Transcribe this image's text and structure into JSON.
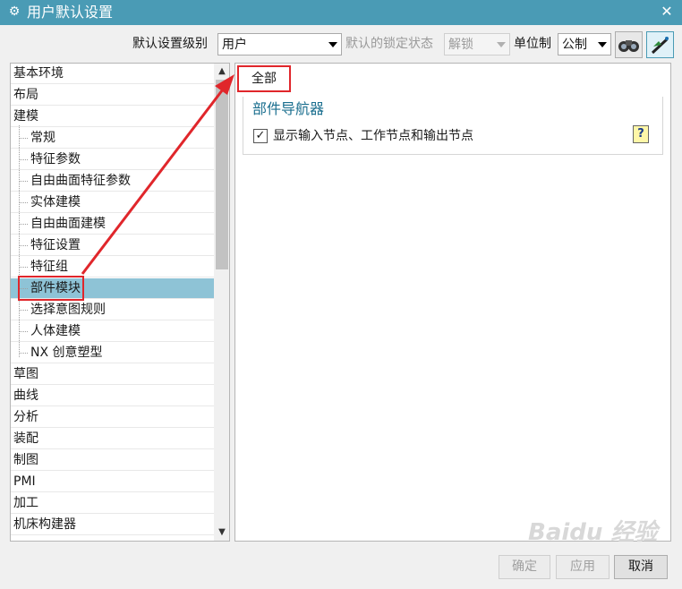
{
  "window": {
    "title": "用户默认设置",
    "close_label": "✕",
    "title_icon": "⚙"
  },
  "toolbar": {
    "level_label": "默认设置级别",
    "level_value": "用户",
    "lock_label": "默认的锁定状态",
    "lock_value": "解锁",
    "unit_label": "单位制",
    "unit_value": "公制"
  },
  "tree": {
    "items": [
      {
        "label": "基本环境",
        "level": 0
      },
      {
        "label": "布局",
        "level": 0
      },
      {
        "label": "建模",
        "level": 0
      },
      {
        "label": "常规",
        "level": 1
      },
      {
        "label": "特征参数",
        "level": 1
      },
      {
        "label": "自由曲面特征参数",
        "level": 1
      },
      {
        "label": "实体建模",
        "level": 1
      },
      {
        "label": "自由曲面建模",
        "level": 1
      },
      {
        "label": "特征设置",
        "level": 1
      },
      {
        "label": "特征组",
        "level": 1
      },
      {
        "label": "部件模块",
        "level": 1,
        "selected": true
      },
      {
        "label": "选择意图规则",
        "level": 1
      },
      {
        "label": "人体建模",
        "level": 1
      },
      {
        "label": "NX 创意塑型",
        "level": 1
      },
      {
        "label": "草图",
        "level": 0
      },
      {
        "label": "曲线",
        "level": 0
      },
      {
        "label": "分析",
        "level": 0
      },
      {
        "label": "装配",
        "level": 0
      },
      {
        "label": "制图",
        "level": 0
      },
      {
        "label": "PMI",
        "level": 0
      },
      {
        "label": "加工",
        "level": 0
      },
      {
        "label": "机床构建器",
        "level": 0
      }
    ],
    "scroll_up": "▲",
    "scroll_down": "▼"
  },
  "panel": {
    "tab_label": "全部",
    "group_title": "部件导航器",
    "checkbox_label": "显示输入节点、工作节点和输出节点",
    "checkbox_checked": true,
    "checkbox_mark": "✓",
    "help_mark": "?"
  },
  "buttons": {
    "ok": "确定",
    "apply": "应用",
    "cancel": "取消"
  },
  "watermark": "Baidu 经验",
  "colors": {
    "titlebar": "#4a9bb5",
    "selection": "#8ec3d6",
    "highlight": "#e0262b",
    "group_title": "#1b6f8f"
  }
}
